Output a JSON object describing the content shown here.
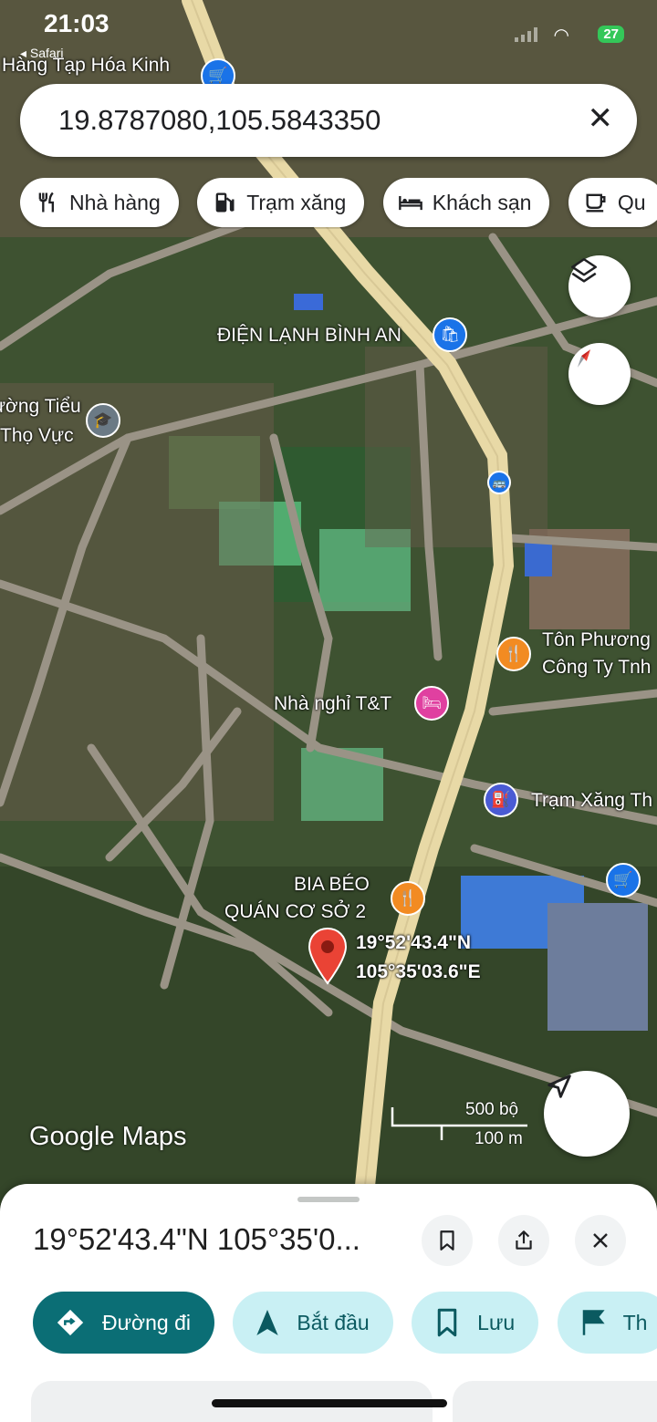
{
  "status_bar": {
    "time": "21:03",
    "back_app": "◂ Safari",
    "battery": "27"
  },
  "search": {
    "query": "19.8787080,105.5843350"
  },
  "chips": [
    {
      "label": "Nhà hàng",
      "icon": "restaurant-icon"
    },
    {
      "label": "Trạm xăng",
      "icon": "gas-station-icon"
    },
    {
      "label": "Khách sạn",
      "icon": "hotel-icon"
    },
    {
      "label": "Qu",
      "icon": "cafe-icon"
    }
  ],
  "map": {
    "labels": {
      "store_top": "Hàng Tạp Hóa Kinh",
      "dien_lanh": "ĐIỆN LẠNH BÌNH AN",
      "school_1": "ường Tiểu",
      "school_2": "Thọ Vực",
      "ton_phuong_1": "Tôn Phương",
      "ton_phuong_2": "Công Ty Tnh",
      "nha_nghi": "Nhà nghỉ T&T",
      "tram_xang": "Trạm Xăng Th",
      "bia_1": "BIA BÉO",
      "bia_2": "QUÁN CƠ SỞ 2",
      "pin_lat": "19°52'43.4\"N",
      "pin_lng": "105°35'03.6\"E"
    },
    "logo": "Google Maps",
    "scale_imperial": "500 bộ",
    "scale_metric": "100 m",
    "colors": {
      "road": "#e8d9a6",
      "poi_orange": "#f28b22",
      "poi_blue": "#1a73e8",
      "poi_pink": "#e040a0",
      "pin": "#ea4335"
    }
  },
  "sheet": {
    "title": "19°52'43.4\"N 105°35'0...",
    "actions": [
      {
        "label": "Đường đi",
        "icon": "directions-icon"
      },
      {
        "label": "Bắt đầu",
        "icon": "navigation-arrow-icon"
      },
      {
        "label": "Lưu",
        "icon": "bookmark-icon"
      },
      {
        "label": "Th",
        "icon": "flag-icon"
      }
    ]
  }
}
